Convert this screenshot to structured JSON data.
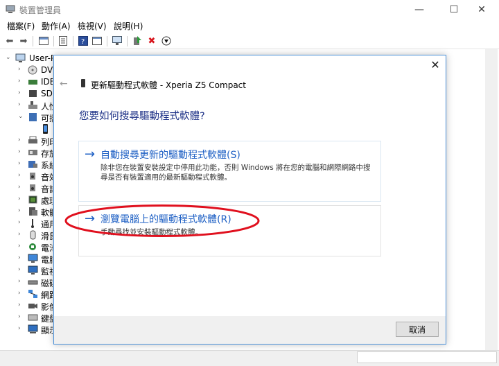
{
  "window": {
    "title": "裝置管理員",
    "buttons": [
      "—",
      "☐",
      "✕"
    ]
  },
  "menu": [
    "檔案(F)",
    "動作(A)",
    "檢視(V)",
    "說明(H)"
  ],
  "tree": {
    "root": "User-P",
    "items": [
      {
        "label": "DV",
        "icon": "dvd-drive-icon"
      },
      {
        "label": "IDE",
        "icon": "ide-controller-icon"
      },
      {
        "label": "SD",
        "icon": "sd-host-icon"
      },
      {
        "label": "人性",
        "icon": "human-interface-icon"
      },
      {
        "label": "可攜",
        "icon": "portable-device-icon"
      },
      {
        "label": "",
        "icon": "phone-icon"
      },
      {
        "label": "列印",
        "icon": "print-queue-icon"
      },
      {
        "label": "存放",
        "icon": "storage-controller-icon"
      },
      {
        "label": "系統",
        "icon": "system-device-icon"
      },
      {
        "label": "音效",
        "icon": "audio-io-icon"
      },
      {
        "label": "音訊",
        "icon": "sound-controller-icon"
      },
      {
        "label": "處理",
        "icon": "processor-icon"
      },
      {
        "label": "軟體",
        "icon": "software-device-icon"
      },
      {
        "label": "通用",
        "icon": "usb-controller-icon"
      },
      {
        "label": "滑鼠",
        "icon": "mouse-icon"
      },
      {
        "label": "電池",
        "icon": "battery-icon"
      },
      {
        "label": "電腦",
        "icon": "computer-icon"
      },
      {
        "label": "監視",
        "icon": "monitor-icon"
      },
      {
        "label": "磁碟",
        "icon": "disk-drive-icon"
      },
      {
        "label": "網路",
        "icon": "network-adapter-icon"
      },
      {
        "label": "影像",
        "icon": "imaging-device-icon"
      },
      {
        "label": "鍵盤",
        "icon": "keyboard-icon"
      },
      {
        "label": "顯示",
        "icon": "display-adapter-icon"
      }
    ]
  },
  "dialog": {
    "title": "更新驅動程式軟體 - Xperia Z5 Compact",
    "heading": "您要如何搜尋驅動程式軟體?",
    "option1": {
      "arrow": "→",
      "title": "自動搜尋更新的驅動程式軟體(S)",
      "desc": "除非您在裝置安裝設定中停用此功能，否則 Windows 將在您的電腦和網際網路中搜尋是否有裝置適用的最新驅動程式軟體。"
    },
    "option2": {
      "arrow": "→",
      "title": "瀏覽電腦上的驅動程式軟體(R)",
      "desc": "手動尋找並安裝驅動程式軟體。"
    },
    "cancel": "取消",
    "close": "✕",
    "back": "←"
  },
  "colors": {
    "accent": "#1d5fc4",
    "heading": "#1e3287",
    "highlight": "#e0101e"
  }
}
